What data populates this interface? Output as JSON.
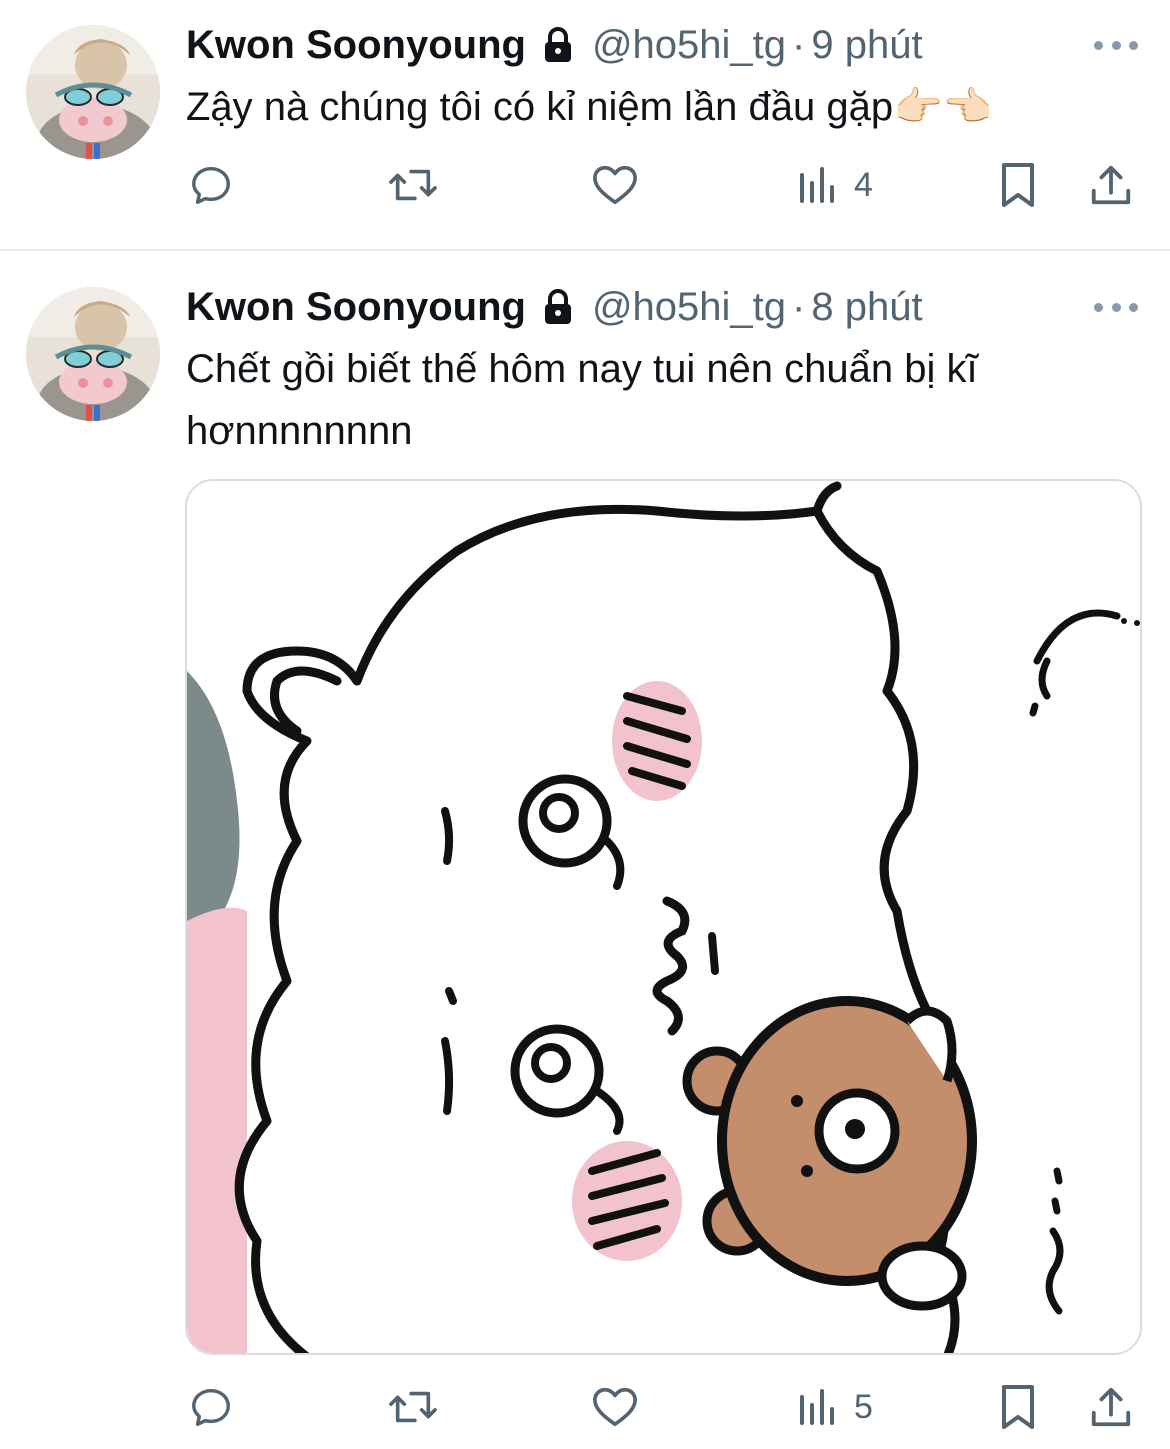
{
  "tweets": [
    {
      "name": "Kwon Soonyoung",
      "handle": "@ho5hi_tg",
      "separator": "·",
      "time": "9 phút",
      "text": "Zậy nà chúng tôi có kỉ niệm lần đầu gặp👉🏻👈🏻",
      "views": "4"
    },
    {
      "name": "Kwon Soonyoung",
      "handle": "@ho5hi_tg",
      "separator": "·",
      "time": "8 phút",
      "text": "Chết gồi biết thế hôm nay tui nên chuẩn bị kĩ hơnnnnnnnn",
      "views": "5"
    }
  ],
  "colors": {
    "text": "#0f1419",
    "secondary": "#536471",
    "divider": "#e6e9eb",
    "blush": "#f3c3cd",
    "bear": "#c48e6c"
  }
}
